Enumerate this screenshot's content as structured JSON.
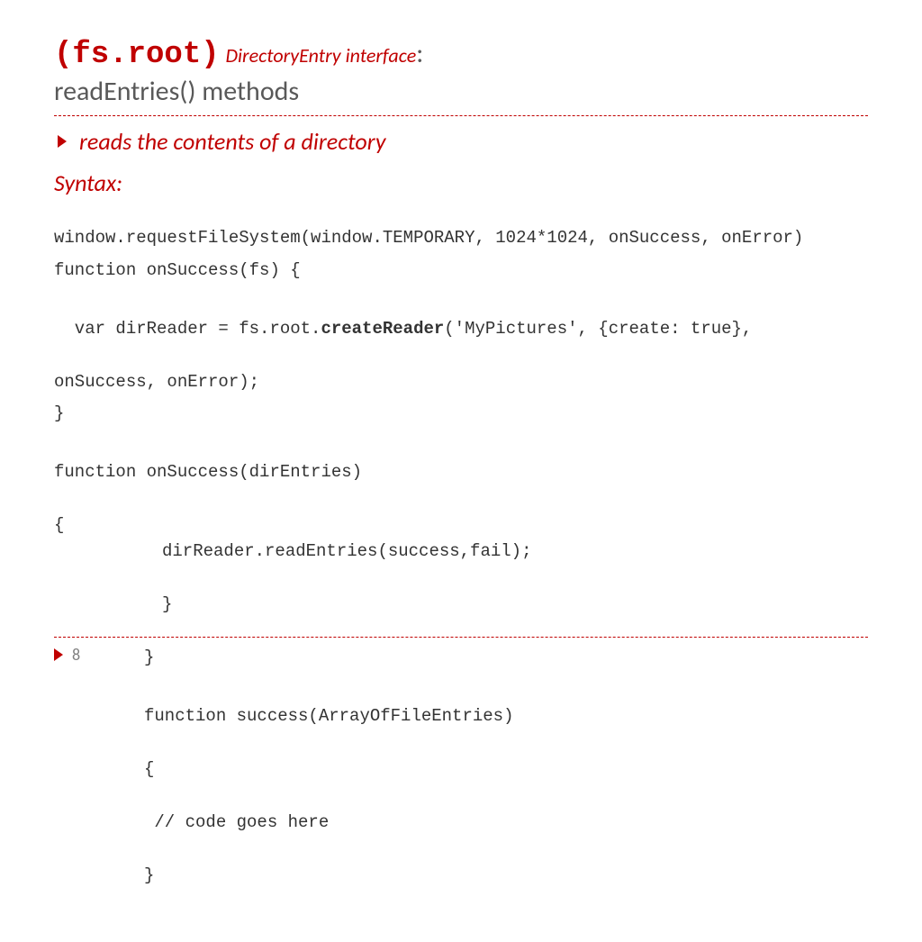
{
  "title": {
    "code": "(fs.root)",
    "em": "DirectoryEntry interface",
    "colon": ":",
    "line2": "readEntries() methods"
  },
  "bullet": "reads the contents of a directory",
  "syntax_label": "Syntax:",
  "code": {
    "l1": "window.requestFileSystem(window.TEMPORARY, 1024*1024, onSuccess, onError)",
    "l2": "function onSuccess(fs) {",
    "l3a": "  var dirReader = fs.root.",
    "l3b": "createReader",
    "l3c": "('MyPictures', {create: true},",
    "l4": "onSuccess, onError);",
    "l5": "}",
    "l6": "function onSuccess(dirEntries)",
    "l7": "{",
    "l8": "dirReader.readEntries(success,fail);",
    "l9": "}",
    "l10": "}",
    "l11": "function success(ArrayOfFileEntries)",
    "l12": "{",
    "l13": " // code goes here",
    "l14": "}"
  },
  "page_number": "8"
}
